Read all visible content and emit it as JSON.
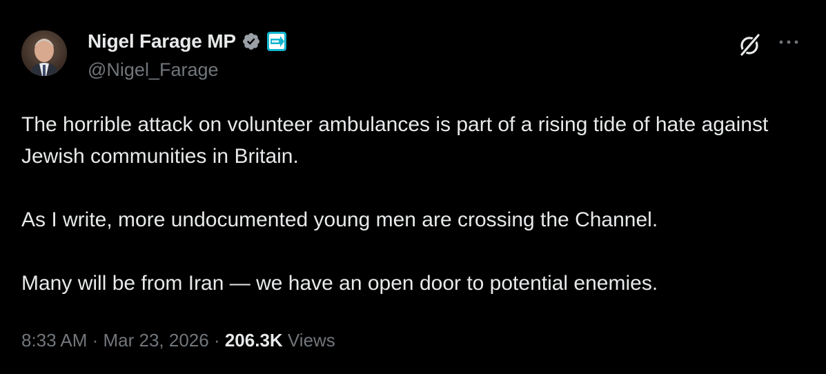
{
  "author": {
    "name": "Nigel Farage MP",
    "handle": "@Nigel_Farage",
    "verified": true,
    "affiliation_badge": "reform-uk-badge",
    "verified_color": "#1d9bf0"
  },
  "header_actions": {
    "grok_icon": "grok-icon",
    "more_icon": "more-icon"
  },
  "tweet": {
    "paragraphs": [
      "The horrible attack on volunteer ambulances is part of a rising tide of hate against Jewish communities in Britain.",
      "As I write, more undocumented young men are crossing the Channel.",
      "Many will be from Iran — we have an open door to potential enemies."
    ]
  },
  "meta": {
    "time": "8:33 AM",
    "separator": " · ",
    "date": "Mar 23, 2026",
    "views_count": "206.3K",
    "views_label": "Views"
  },
  "colors": {
    "background": "#000000",
    "text": "#e7e9ea",
    "secondary": "#71767b",
    "reform_badge": "#12b6cf"
  }
}
